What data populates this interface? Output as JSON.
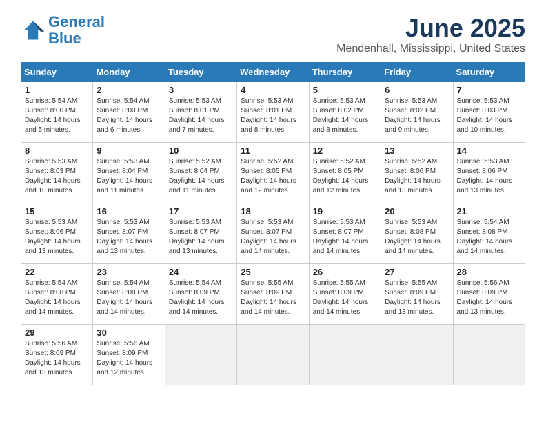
{
  "header": {
    "logo_line1": "General",
    "logo_line2": "Blue",
    "month": "June 2025",
    "location": "Mendenhall, Mississippi, United States"
  },
  "weekdays": [
    "Sunday",
    "Monday",
    "Tuesday",
    "Wednesday",
    "Thursday",
    "Friday",
    "Saturday"
  ],
  "weeks": [
    [
      {
        "day": "1",
        "info": "Sunrise: 5:54 AM\nSunset: 8:00 PM\nDaylight: 14 hours\nand 5 minutes."
      },
      {
        "day": "2",
        "info": "Sunrise: 5:54 AM\nSunset: 8:00 PM\nDaylight: 14 hours\nand 6 minutes."
      },
      {
        "day": "3",
        "info": "Sunrise: 5:53 AM\nSunset: 8:01 PM\nDaylight: 14 hours\nand 7 minutes."
      },
      {
        "day": "4",
        "info": "Sunrise: 5:53 AM\nSunset: 8:01 PM\nDaylight: 14 hours\nand 8 minutes."
      },
      {
        "day": "5",
        "info": "Sunrise: 5:53 AM\nSunset: 8:02 PM\nDaylight: 14 hours\nand 8 minutes."
      },
      {
        "day": "6",
        "info": "Sunrise: 5:53 AM\nSunset: 8:02 PM\nDaylight: 14 hours\nand 9 minutes."
      },
      {
        "day": "7",
        "info": "Sunrise: 5:53 AM\nSunset: 8:03 PM\nDaylight: 14 hours\nand 10 minutes."
      }
    ],
    [
      {
        "day": "8",
        "info": "Sunrise: 5:53 AM\nSunset: 8:03 PM\nDaylight: 14 hours\nand 10 minutes."
      },
      {
        "day": "9",
        "info": "Sunrise: 5:53 AM\nSunset: 8:04 PM\nDaylight: 14 hours\nand 11 minutes."
      },
      {
        "day": "10",
        "info": "Sunrise: 5:52 AM\nSunset: 8:04 PM\nDaylight: 14 hours\nand 11 minutes."
      },
      {
        "day": "11",
        "info": "Sunrise: 5:52 AM\nSunset: 8:05 PM\nDaylight: 14 hours\nand 12 minutes."
      },
      {
        "day": "12",
        "info": "Sunrise: 5:52 AM\nSunset: 8:05 PM\nDaylight: 14 hours\nand 12 minutes."
      },
      {
        "day": "13",
        "info": "Sunrise: 5:52 AM\nSunset: 8:06 PM\nDaylight: 14 hours\nand 13 minutes."
      },
      {
        "day": "14",
        "info": "Sunrise: 5:53 AM\nSunset: 8:06 PM\nDaylight: 14 hours\nand 13 minutes."
      }
    ],
    [
      {
        "day": "15",
        "info": "Sunrise: 5:53 AM\nSunset: 8:06 PM\nDaylight: 14 hours\nand 13 minutes."
      },
      {
        "day": "16",
        "info": "Sunrise: 5:53 AM\nSunset: 8:07 PM\nDaylight: 14 hours\nand 13 minutes."
      },
      {
        "day": "17",
        "info": "Sunrise: 5:53 AM\nSunset: 8:07 PM\nDaylight: 14 hours\nand 13 minutes."
      },
      {
        "day": "18",
        "info": "Sunrise: 5:53 AM\nSunset: 8:07 PM\nDaylight: 14 hours\nand 14 minutes."
      },
      {
        "day": "19",
        "info": "Sunrise: 5:53 AM\nSunset: 8:07 PM\nDaylight: 14 hours\nand 14 minutes."
      },
      {
        "day": "20",
        "info": "Sunrise: 5:53 AM\nSunset: 8:08 PM\nDaylight: 14 hours\nand 14 minutes."
      },
      {
        "day": "21",
        "info": "Sunrise: 5:54 AM\nSunset: 8:08 PM\nDaylight: 14 hours\nand 14 minutes."
      }
    ],
    [
      {
        "day": "22",
        "info": "Sunrise: 5:54 AM\nSunset: 8:08 PM\nDaylight: 14 hours\nand 14 minutes."
      },
      {
        "day": "23",
        "info": "Sunrise: 5:54 AM\nSunset: 8:08 PM\nDaylight: 14 hours\nand 14 minutes."
      },
      {
        "day": "24",
        "info": "Sunrise: 5:54 AM\nSunset: 8:09 PM\nDaylight: 14 hours\nand 14 minutes."
      },
      {
        "day": "25",
        "info": "Sunrise: 5:55 AM\nSunset: 8:09 PM\nDaylight: 14 hours\nand 14 minutes."
      },
      {
        "day": "26",
        "info": "Sunrise: 5:55 AM\nSunset: 8:09 PM\nDaylight: 14 hours\nand 14 minutes."
      },
      {
        "day": "27",
        "info": "Sunrise: 5:55 AM\nSunset: 8:09 PM\nDaylight: 14 hours\nand 13 minutes."
      },
      {
        "day": "28",
        "info": "Sunrise: 5:56 AM\nSunset: 8:09 PM\nDaylight: 14 hours\nand 13 minutes."
      }
    ],
    [
      {
        "day": "29",
        "info": "Sunrise: 5:56 AM\nSunset: 8:09 PM\nDaylight: 14 hours\nand 13 minutes."
      },
      {
        "day": "30",
        "info": "Sunrise: 5:56 AM\nSunset: 8:09 PM\nDaylight: 14 hours\nand 12 minutes."
      },
      {
        "day": "",
        "info": ""
      },
      {
        "day": "",
        "info": ""
      },
      {
        "day": "",
        "info": ""
      },
      {
        "day": "",
        "info": ""
      },
      {
        "day": "",
        "info": ""
      }
    ]
  ]
}
